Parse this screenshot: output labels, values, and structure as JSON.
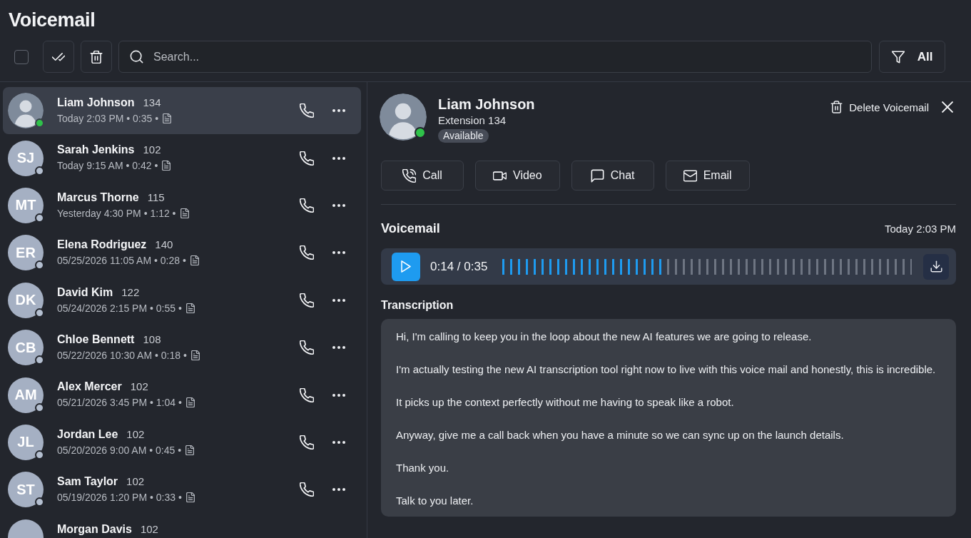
{
  "header": {
    "title": "Voicemail"
  },
  "toolbar": {
    "select_all": {
      "checked": false
    },
    "search": {
      "placeholder": "Search..."
    },
    "filter": {
      "label": "All"
    }
  },
  "voicemails": [
    {
      "name": "Liam Johnson",
      "extension": "134",
      "kind": "photo",
      "details": "Today 2:03 PM • 0:35 •",
      "color": "#2fc24a",
      "selected": true
    },
    {
      "name": "Sarah Jenkins",
      "extension": "102",
      "kind": "initials",
      "initials": "SJ",
      "details": "Today 9:15 AM • 0:42 •",
      "color": "#b4bfd0",
      "selected": false
    },
    {
      "name": "Marcus Thorne",
      "extension": "115",
      "kind": "initials",
      "initials": "MT",
      "details": "Yesterday 4:30 PM • 1:12 •",
      "color": "#b4bfd0",
      "selected": false
    },
    {
      "name": "Elena Rodriguez",
      "extension": "140",
      "kind": "initials",
      "initials": "ER",
      "details": "05/25/2026 11:05 AM • 0:28 •",
      "color": "#b4bfd0",
      "selected": false
    },
    {
      "name": "David Kim",
      "extension": "122",
      "kind": "initials",
      "initials": "DK",
      "details": "05/24/2026 2:15 PM • 0:55 •",
      "color": "#b4bfd0",
      "selected": false
    },
    {
      "name": "Chloe Bennett",
      "extension": "108",
      "kind": "initials",
      "initials": "CB",
      "details": "05/22/2026 10:30 AM • 0:18 •",
      "color": "#b4bfd0",
      "selected": false
    },
    {
      "name": "Alex Mercer",
      "extension": "102",
      "kind": "initials",
      "initials": "AM",
      "details": "05/21/2026 3:45 PM • 1:04 •",
      "color": "#b4bfd0",
      "selected": false
    },
    {
      "name": "Jordan Lee",
      "extension": "102",
      "kind": "initials",
      "initials": "JL",
      "details": "05/20/2026 9:00 AM • 0:45 •",
      "color": "#b4bfd0",
      "selected": false
    },
    {
      "name": "Sam Taylor",
      "extension": "102",
      "kind": "initials",
      "initials": "ST",
      "details": "05/19/2026 1:20 PM • 0:33 •",
      "color": "#b4bfd0",
      "selected": false
    },
    {
      "name": "Morgan Davis",
      "extension": "102",
      "kind": "initials",
      "selected": false
    }
  ],
  "detail": {
    "contact": {
      "name": "Liam Johnson",
      "extension": "Extension 134",
      "status": "Available"
    },
    "delete_label": "Delete Voicemail",
    "actions": [
      {
        "kind": "call",
        "label": "Call"
      },
      {
        "kind": "video",
        "label": "Video"
      },
      {
        "kind": "chat",
        "label": "Chat"
      },
      {
        "kind": "email",
        "label": "Email"
      }
    ],
    "voicemail": {
      "title": "Voicemail",
      "time": "Today 2:03 PM",
      "player": {
        "position": "0:14 / 0:35",
        "level": 0.4
      }
    },
    "transcription": {
      "title": "Transcription",
      "paragraphs": [
        "Hi, I'm calling to keep you in the loop about the new AI features we are going to release.",
        "I'm actually testing the new AI transcription tool right now to live with this voice mail and honestly, this is incredible.",
        "It picks up the context perfectly without me having to speak like a robot.",
        "Anyway, give me a call back when you have a minute so we can sync up on the launch details.",
        "Thank you.",
        "Talk to you later."
      ]
    }
  }
}
